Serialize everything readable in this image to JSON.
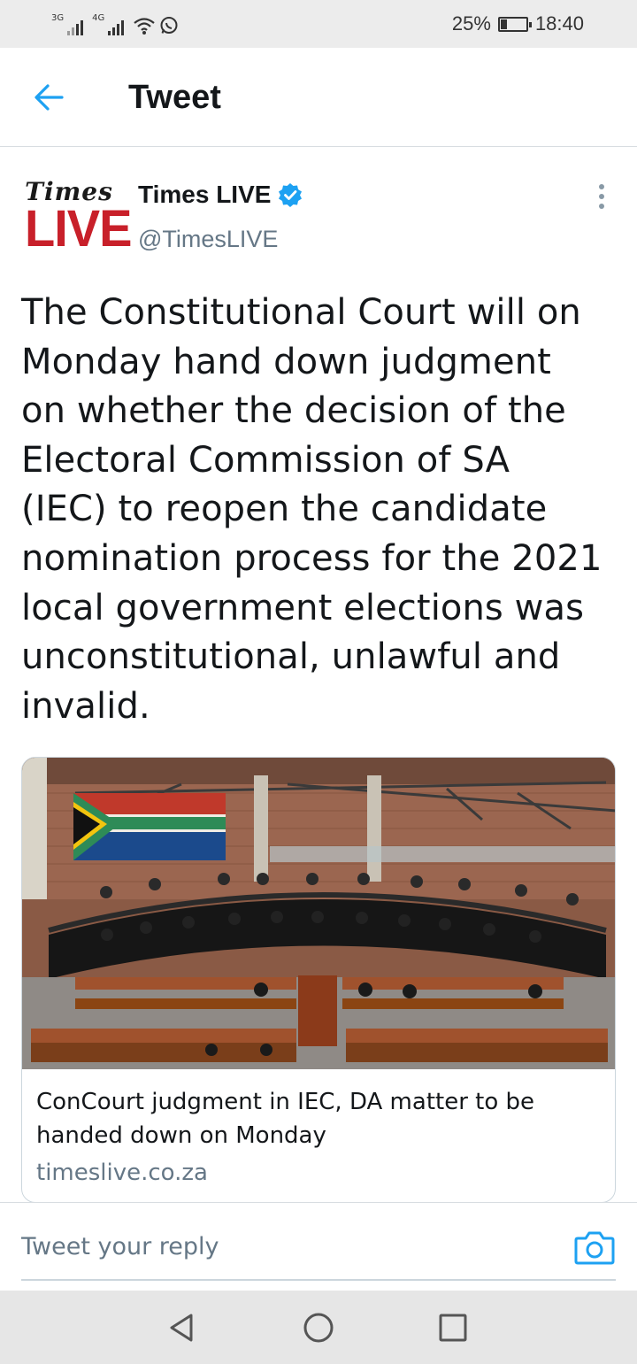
{
  "status_bar": {
    "network_1": "3G",
    "network_2": "4G",
    "battery_percent": "25%",
    "battery_level": 0.25,
    "time": "18:40",
    "icons": [
      "signal-icon",
      "signal-icon",
      "wifi-icon",
      "whatsapp-icon",
      "battery-charging-icon"
    ]
  },
  "header": {
    "back_icon": "arrow-left-icon",
    "title": "Tweet"
  },
  "tweet": {
    "logo_text_top": "Times",
    "logo_text_bottom": "LIVE",
    "author_name": "Times LIVE",
    "verified": true,
    "handle": "@TimesLIVE",
    "text": "The Constitutional Court will on\nMonday hand down judgment\non whether the decision of the\nElectoral Commission of SA\n(IEC) to reopen the candidate\nnomination process for the 2021\nlocal government elections was\nunconstitutional, unlawful and\ninvalid.",
    "more_icon": "more-vertical-icon"
  },
  "card": {
    "image": "constitutional-court-chamber-photo",
    "title": "ConCourt judgment in IEC, DA matter to be\nhanded down on Monday",
    "domain": "timeslive.co.za"
  },
  "reply": {
    "placeholder": "Tweet your reply",
    "camera_icon": "camera-icon"
  },
  "nav_bar": {
    "buttons": [
      "nav-back-icon",
      "nav-home-icon",
      "nav-recents-icon"
    ]
  },
  "colors": {
    "accent": "#1da1f2",
    "logo_red": "#c8202a",
    "muted_text": "#657786"
  }
}
